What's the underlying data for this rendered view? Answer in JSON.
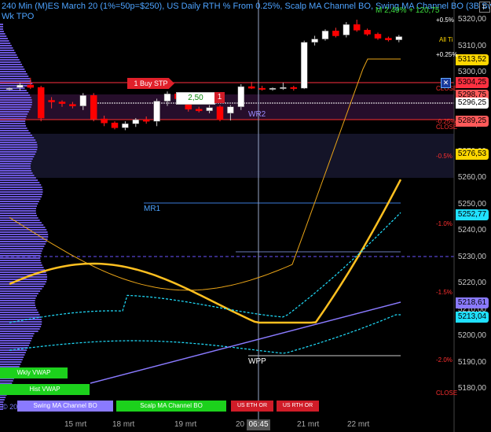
{
  "header": {
    "line1": "240 Min (M)ES March 20 (1%=50p=$250), US Daily RTH % From 0.25%, Scalp MA Channel BO, Swing MA Channel BO (3B Sw",
    "line2": "Wk TPO",
    "perf": "M 2,49% + 120,75",
    "all_time": "All Ti",
    "corner": "F"
  },
  "price_axis": {
    "ticks": [
      "5320,00",
      "5310,00",
      "5300,00",
      "5290,00",
      "5280,00",
      "5270,00",
      "5260,00",
      "5250,00",
      "5240,00",
      "5230,00",
      "5220,00",
      "5210,00",
      "5200,00",
      "5190,00",
      "5180,00"
    ]
  },
  "price_boxes": [
    {
      "label": "5313,52",
      "bg": "#ffd700",
      "fg": "#000"
    },
    {
      "label": "5304,25",
      "bg": "#ff3040",
      "fg": "#000"
    },
    {
      "label": "5298,75",
      "bg": "#ff5a5a",
      "fg": "#000"
    },
    {
      "label": "5296,25",
      "bg": "#ffffff",
      "fg": "#000"
    },
    {
      "label": "5289,25",
      "bg": "#ff5a5a",
      "fg": "#000"
    },
    {
      "label": "5276,53",
      "bg": "#ffd700",
      "fg": "#000"
    },
    {
      "label": "5252,77",
      "bg": "#20e0ff",
      "fg": "#000"
    },
    {
      "label": "5218,61",
      "bg": "#8a7aff",
      "fg": "#000"
    },
    {
      "label": "5213,04",
      "bg": "#20e0ff",
      "fg": "#000"
    }
  ],
  "percent_labels": [
    {
      "text": "+0.5%",
      "color": "#ffffff"
    },
    {
      "text": "+0.25%",
      "color": "#ffffff"
    },
    {
      "text": "CLOSE",
      "color": "#ff3030"
    },
    {
      "text": "-0.25%",
      "color": "#ff3030"
    },
    {
      "text": "CLOSE",
      "color": "#ff3030"
    },
    {
      "text": "-0.5%",
      "color": "#ff3030"
    },
    {
      "text": "-1.0%",
      "color": "#ff3030"
    },
    {
      "text": "-1.5%",
      "color": "#ff3030"
    },
    {
      "text": "-2.0%",
      "color": "#ff3030"
    },
    {
      "text": "CLOSE",
      "color": "#ff3030"
    }
  ],
  "levels": {
    "wr2": "WR2",
    "mr1": "MR1",
    "wpp": "WPP"
  },
  "order": {
    "label": "1 Buy STP",
    "qty": "2,50",
    "count": "1",
    "close": "✕"
  },
  "x_axis": {
    "dates": [
      "15 mrt",
      "18 mrt",
      "19 mrt",
      "20",
      "21 mrt",
      "22 mrt"
    ],
    "crosshair": "06:45"
  },
  "bottom_buttons": {
    "wkly_vwap": "Wkly VWAP",
    "hist_vwap": "Hist VWAP",
    "swing": "Swing MA Channel BO",
    "scalp": "Scalp MA Channel BO",
    "us_eth_or": "US ETH OR",
    "us_rth_or": "US RTH OR"
  },
  "copyright": "© 20",
  "colors": {
    "up": "#ffffff",
    "down": "#ff0000",
    "accent": "#4da3ff",
    "ma_fast": "#e8a317",
    "ma_slow": "#ffc020",
    "channel": "#20e0ff",
    "trend": "#8a7aff"
  },
  "chart_data": {
    "type": "candlestick",
    "timeframe": "240 Min",
    "symbol": "ES March 20",
    "x": [
      "15 mrt",
      "18 mrt",
      "19 mrt",
      "20",
      "21 mrt",
      "22 mrt"
    ],
    "candles": [
      [
        5236,
        5238,
        5234,
        5237
      ],
      [
        5238,
        5244,
        5234,
        5241
      ],
      [
        5241,
        5250,
        5236,
        5238
      ],
      [
        5238,
        5240,
        5196,
        5200
      ],
      [
        5222,
        5226,
        5212,
        5220
      ],
      [
        5220,
        5222,
        5214,
        5218
      ],
      [
        5217,
        5220,
        5212,
        5215
      ],
      [
        5215,
        5231,
        5210,
        5228
      ],
      [
        5228,
        5231,
        5196,
        5199
      ],
      [
        5199,
        5203,
        5190,
        5194
      ],
      [
        5194,
        5196,
        5186,
        5188
      ],
      [
        5188,
        5196,
        5185,
        5193
      ],
      [
        5193,
        5200,
        5189,
        5198
      ],
      [
        5198,
        5202,
        5193,
        5196
      ],
      [
        5196,
        5224,
        5190,
        5221
      ],
      [
        5221,
        5233,
        5215,
        5230
      ],
      [
        5230,
        5232,
        5221,
        5224
      ],
      [
        5224,
        5226,
        5208,
        5211
      ],
      [
        5211,
        5214,
        5207,
        5209
      ],
      [
        5209,
        5216,
        5206,
        5213
      ],
      [
        5214,
        5216,
        5196,
        5198
      ],
      [
        5206,
        5216,
        5197,
        5214
      ],
      [
        5214,
        5242,
        5210,
        5239
      ],
      [
        5239,
        5245,
        5236,
        5237
      ],
      [
        5237,
        5240,
        5234,
        5236
      ],
      [
        5236,
        5238,
        5234,
        5237
      ],
      [
        5237,
        5244,
        5235,
        5238
      ],
      [
        5238,
        5240,
        5234,
        5237
      ],
      [
        5237,
        5296,
        5236,
        5294
      ],
      [
        5294,
        5302,
        5290,
        5298
      ],
      [
        5298,
        5310,
        5296,
        5308
      ],
      [
        5308,
        5312,
        5300,
        5302
      ],
      [
        5303,
        5319,
        5300,
        5316
      ],
      [
        5316,
        5322,
        5307,
        5309
      ],
      [
        5309,
        5311,
        5302,
        5304
      ],
      [
        5304,
        5306,
        5297,
        5299
      ],
      [
        5299,
        5301,
        5295,
        5297
      ],
      [
        5297,
        5303,
        5294,
        5301
      ]
    ]
  }
}
